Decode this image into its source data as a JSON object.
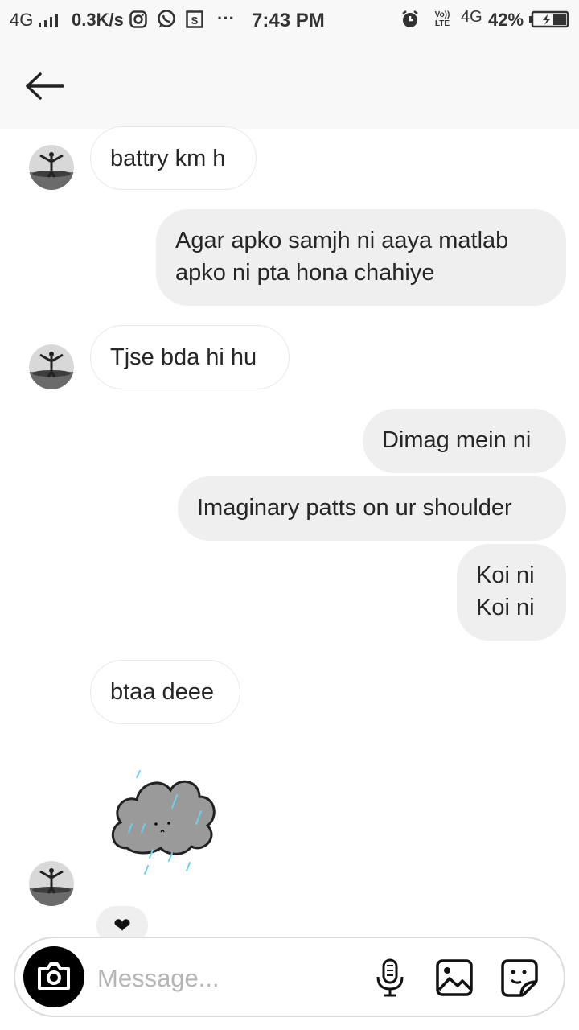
{
  "status_bar": {
    "network": "4G",
    "speed": "0.3K/s",
    "dots": "···",
    "time": "7:43 PM",
    "volte": "Vo)) LTE",
    "network2": "4G",
    "battery": "42%"
  },
  "messages": [
    {
      "side": "in",
      "text": "battry km h"
    },
    {
      "side": "out",
      "text": "Agar apko samjh ni aaya matlab\napko ni pta hona chahiye"
    },
    {
      "side": "in",
      "text": "Tjse bda hi hu"
    },
    {
      "side": "out",
      "text": "Dimag mein ni"
    },
    {
      "side": "out",
      "text": "Imaginary patts on ur shoulder"
    },
    {
      "side": "out",
      "text": "Koi ni\nKoi ni"
    },
    {
      "side": "in",
      "text": "btaa deee"
    }
  ],
  "sticker": {
    "icon": "rain-cloud-sticker"
  },
  "reaction": {
    "emoji": "❤"
  },
  "composer": {
    "placeholder": "Message..."
  },
  "colors": {
    "incoming_bg": "#ffffff",
    "outgoing_bg": "#efefef",
    "header_bg": "#f8f8f8"
  }
}
